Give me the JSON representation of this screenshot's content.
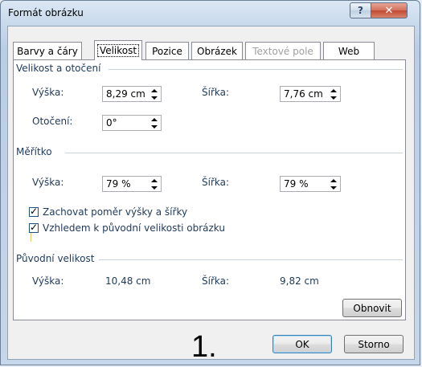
{
  "window": {
    "title": "Formát obrázku",
    "help_label": "?",
    "close_label": "✕"
  },
  "tabs": [
    {
      "label": "Barvy a čáry"
    },
    {
      "label": "Velikost"
    },
    {
      "label": "Pozice"
    },
    {
      "label": "Obrázek"
    },
    {
      "label": "Textové pole"
    },
    {
      "label": "Web"
    }
  ],
  "active_tab": "Velikost",
  "size_rotation": {
    "title": "Velikost a otočení",
    "height_label": "Výška:",
    "height_value": "8,29 cm",
    "width_label": "Šířka:",
    "width_value": "7,76 cm",
    "rotation_label": "Otočení:",
    "rotation_value": "0°"
  },
  "scale": {
    "title": "Měřítko",
    "height_label": "Výška:",
    "height_value": "79 %",
    "width_label": "Šířka:",
    "width_value": "79 %",
    "lock_aspect_label": "Zachovat poměr výšky a šířky",
    "lock_aspect_checked": true,
    "relative_original_label": "Vzhledem k původní velikosti obrázku",
    "relative_original_checked": true
  },
  "original_size": {
    "title": "Původní velikost",
    "height_label": "Výška:",
    "height_value": "10,48 cm",
    "width_label": "Šířka:",
    "width_value": "9,82 cm",
    "reset_label": "Obnovit"
  },
  "annotation": "1.",
  "footer": {
    "ok_label": "OK",
    "cancel_label": "Storno"
  }
}
